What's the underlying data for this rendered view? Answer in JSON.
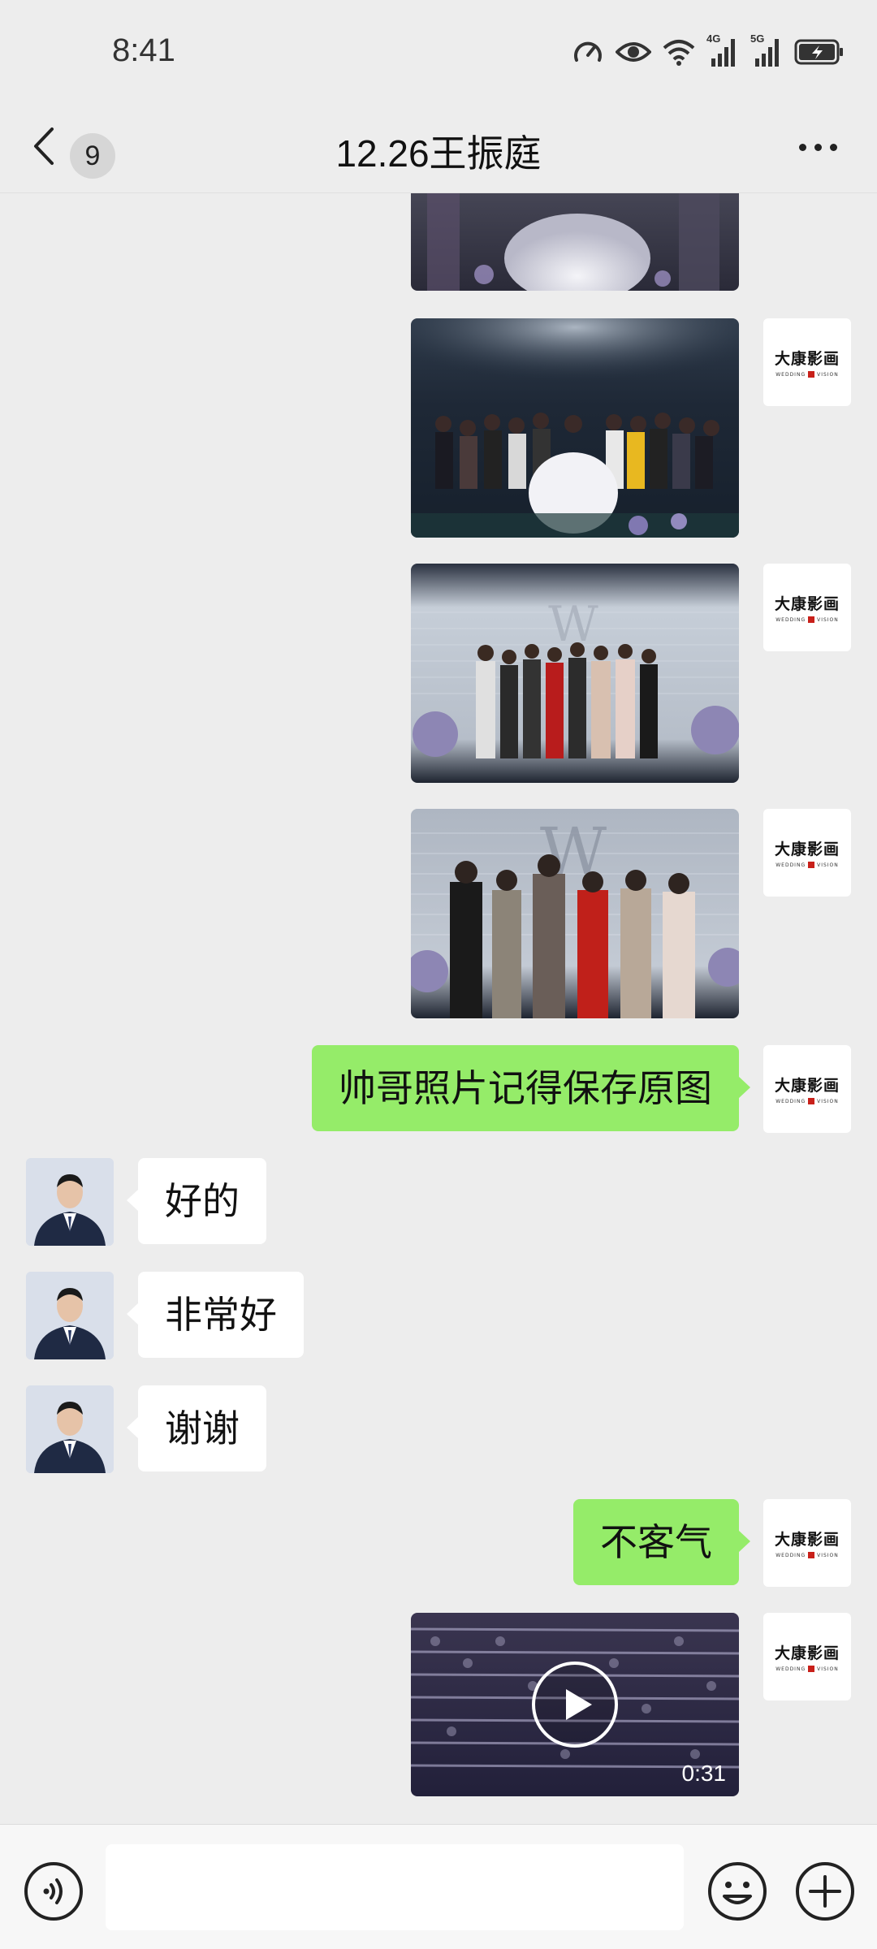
{
  "status_bar": {
    "time": "8:41",
    "icons": [
      "speed-icon",
      "eye-icon",
      "wifi-icon",
      "signal-4g-icon",
      "signal-5g-icon",
      "battery-charging-icon"
    ],
    "net_4g": "4G",
    "net_5g": "5G"
  },
  "nav": {
    "unread_count": "9",
    "title": "12.26王振庭"
  },
  "brand_avatar": {
    "name": "大康影画",
    "sub_left": "WEDDING",
    "sub_right": "VISION"
  },
  "messages": [
    {
      "type": "image",
      "sender": "me",
      "scene": "bride-gown"
    },
    {
      "type": "image",
      "sender": "me",
      "scene": "group-crowd"
    },
    {
      "type": "image",
      "sender": "me",
      "scene": "group-stage"
    },
    {
      "type": "image",
      "sender": "me",
      "scene": "group-small"
    },
    {
      "type": "text",
      "sender": "me",
      "text": "帅哥照片记得保存原图"
    },
    {
      "type": "text",
      "sender": "other",
      "text": "好的"
    },
    {
      "type": "text",
      "sender": "other",
      "text": "非常好"
    },
    {
      "type": "text",
      "sender": "other",
      "text": "谢谢"
    },
    {
      "type": "text",
      "sender": "me",
      "text": "不客气"
    },
    {
      "type": "video",
      "sender": "me",
      "duration": "0:31"
    }
  ],
  "input": {
    "value": "",
    "placeholder": ""
  },
  "colors": {
    "background": "#ededed",
    "bubble_out": "#95ec69",
    "bubble_in": "#ffffff"
  }
}
